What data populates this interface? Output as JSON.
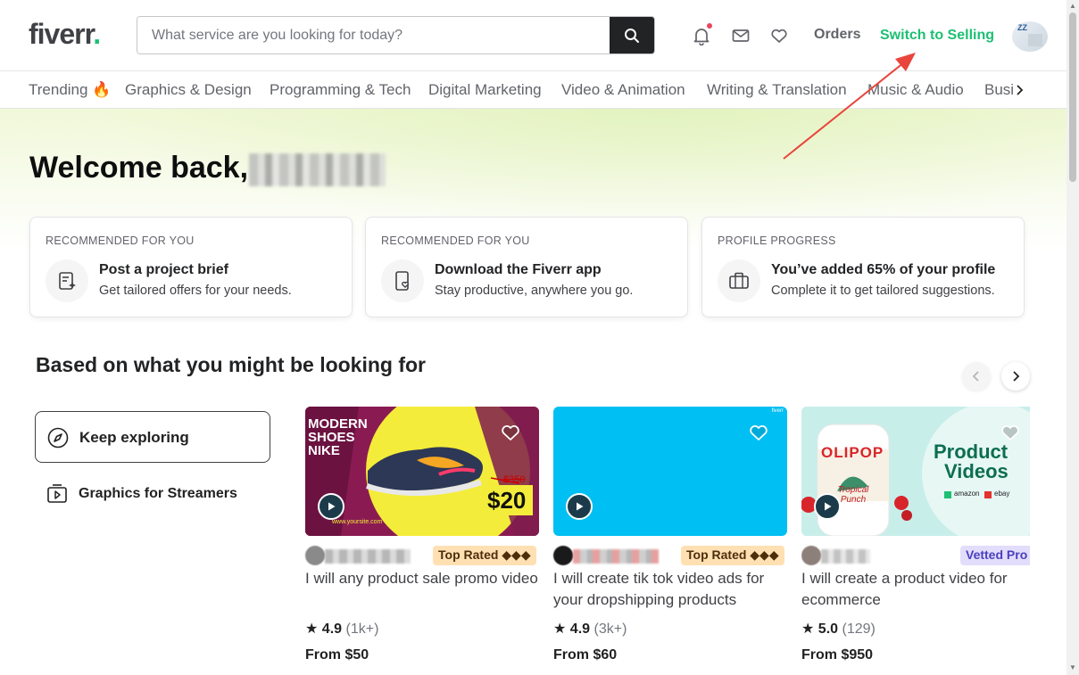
{
  "header": {
    "logo": "fiverr",
    "logo_dot": ".",
    "search_placeholder": "What service are you looking for today?",
    "orders": "Orders",
    "switch_selling": "Switch to Selling",
    "avatar_text": "ZZ"
  },
  "categories": [
    "Trending",
    "Graphics & Design",
    "Programming & Tech",
    "Digital Marketing",
    "Video & Animation",
    "Writing & Translation",
    "Music & Audio",
    "Busin"
  ],
  "trending_emoji": "🔥",
  "hero": {
    "welcome": "Welcome back,"
  },
  "cards": [
    {
      "label": "RECOMMENDED FOR YOU",
      "title": "Post a project brief",
      "subtitle": "Get tailored offers for your needs.",
      "icon": "brief-icon"
    },
    {
      "label": "RECOMMENDED FOR YOU",
      "title": "Download the Fiverr app",
      "subtitle": "Stay productive, anywhere you go.",
      "icon": "phone-heart-icon"
    },
    {
      "label": "PROFILE PROGRESS",
      "title": "You’ve added 65% of your profile",
      "subtitle": "Complete it to get tailored suggestions.",
      "icon": "briefcase-icon",
      "progress_percent": 65
    }
  ],
  "section": {
    "title": "Based on what you might be looking for",
    "keep_exploring": "Keep exploring",
    "graphics_streamers": "Graphics for Streamers"
  },
  "gigs": [
    {
      "badge": "Top Rated ◆◆◆",
      "badge_type": "top",
      "title": "I will any product sale promo video",
      "rating": "4.9",
      "count": "(1k+)",
      "price": "From $50",
      "thumb": {
        "line1": "MODERN",
        "line2": "SHOES",
        "line3": "NIKE",
        "old_price": "$350",
        "new_price": "$20",
        "site": "www.yoursite.com"
      }
    },
    {
      "badge": "Top Rated ◆◆◆",
      "badge_type": "top",
      "title": "I will create tik tok video ads for your dropshipping products",
      "rating": "4.9",
      "count": "(3k+)",
      "price": "From $60",
      "thumb": {
        "corner": "fiverr"
      }
    },
    {
      "badge": "Vetted Pro",
      "badge_type": "vetted",
      "title": "I will create a product video for ecommerce",
      "rating": "5.0",
      "count": "(129)",
      "price": "From $950",
      "thumb": {
        "brand": "OLIPOP",
        "flavor": "Tropical Punch",
        "heading1": "Product",
        "heading2": "Videos",
        "shops": [
          "amazon",
          "ebay"
        ]
      }
    }
  ],
  "colors": {
    "brand_green": "#1dbf73",
    "annotation_red": "#e8453c"
  }
}
